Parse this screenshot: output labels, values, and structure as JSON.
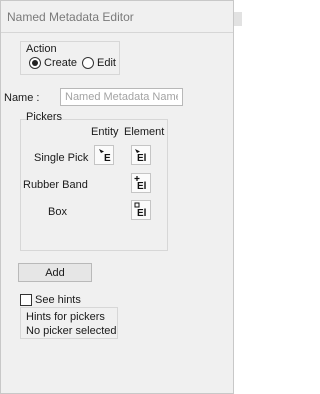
{
  "window": {
    "title": "Named Metadata Editor"
  },
  "action": {
    "group_label": "Action",
    "options": [
      {
        "label": "Create",
        "selected": true
      },
      {
        "label": "Edit",
        "selected": false
      }
    ]
  },
  "name_field": {
    "label": "Name :",
    "value": "",
    "placeholder": "Named Metadata Name"
  },
  "pickers": {
    "group_label": "Pickers",
    "columns": [
      "Entity",
      "Element"
    ],
    "rows": [
      {
        "label": "Single Pick",
        "entity_glyph": "E",
        "element_glyph": "El"
      },
      {
        "label": "Rubber Band",
        "element_glyph": "El"
      },
      {
        "label": "Box",
        "element_glyph": "El"
      }
    ]
  },
  "add_button": {
    "label": "Add"
  },
  "see_hints": {
    "label": "See hints",
    "checked": false
  },
  "hints": {
    "title": "Hints for pickers",
    "text": "No picker selected"
  }
}
